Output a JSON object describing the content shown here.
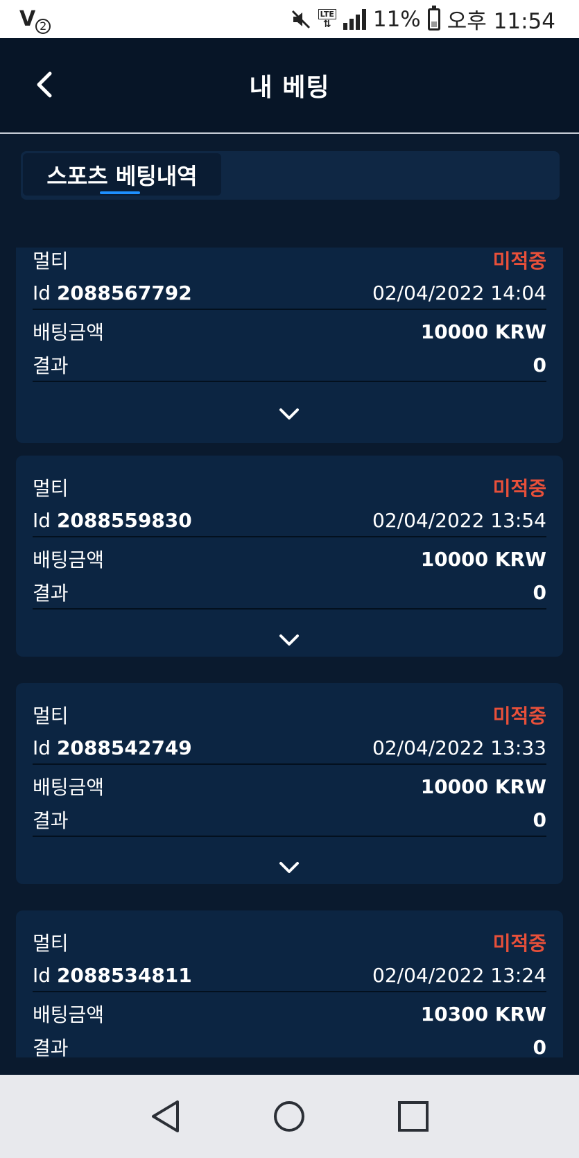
{
  "status_bar": {
    "carrier_badge": "V",
    "carrier_badge_sub": "2",
    "network": "LTE",
    "battery_percent": "11%",
    "time": "오후 11:54"
  },
  "header": {
    "title": "내 베팅"
  },
  "tabs": [
    {
      "label": "스포츠 베팅내역",
      "active": true
    }
  ],
  "bets": [
    {
      "type": "멀티",
      "status": "미적중",
      "id_prefix": "Id",
      "id": "2088567792",
      "datetime": "02/04/2022 14:04",
      "amount_label": "배팅금액",
      "amount": "10000 KRW",
      "result_label": "결과",
      "result": "0"
    },
    {
      "type": "멀티",
      "status": "미적중",
      "id_prefix": "Id",
      "id": "2088559830",
      "datetime": "02/04/2022 13:54",
      "amount_label": "배팅금액",
      "amount": "10000 KRW",
      "result_label": "결과",
      "result": "0"
    },
    {
      "type": "멀티",
      "status": "미적중",
      "id_prefix": "Id",
      "id": "2088542749",
      "datetime": "02/04/2022 13:33",
      "amount_label": "배팅금액",
      "amount": "10000 KRW",
      "result_label": "결과",
      "result": "0"
    },
    {
      "type": "멀티",
      "status": "미적중",
      "id_prefix": "Id",
      "id": "2088534811",
      "datetime": "02/04/2022 13:24",
      "amount_label": "배팅금액",
      "amount": "10300 KRW",
      "result_label": "결과",
      "result": "0"
    }
  ],
  "colors": {
    "background": "#0a1a2e",
    "card": "#0c2542",
    "status_lost": "#e8503a",
    "tab_accent": "#1e90ff"
  },
  "icons": {
    "back": "chevron-left-icon",
    "expand": "chevron-down-icon",
    "nav_back": "triangle-back-icon",
    "nav_home": "circle-home-icon",
    "nav_recent": "square-recent-icon"
  }
}
